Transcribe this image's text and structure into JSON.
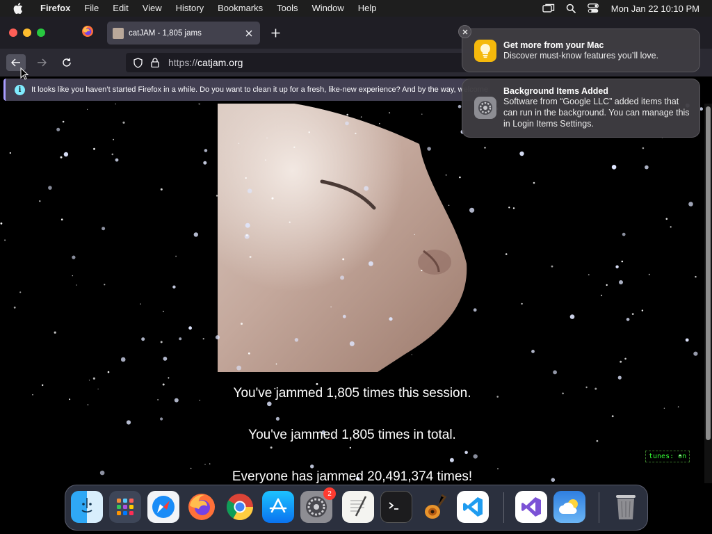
{
  "menubar": {
    "app_name": "Firefox",
    "items": [
      "File",
      "Edit",
      "View",
      "History",
      "Bookmarks",
      "Tools",
      "Window",
      "Help"
    ],
    "clock": "Mon Jan 22  10:10 PM"
  },
  "browser": {
    "tab_title": "catJAM - 1,805 jams",
    "url_protocol": "https://",
    "url_host": "catjam.org",
    "info_message": "It looks like you haven’t started Firefox in a while. Do you want to clean it up for a fresh, like-new experience? And by the way, welcome back!"
  },
  "page": {
    "session_text": "You've jammed 1,805 times this session.",
    "total_text": "You've jammed 1,805 times in total.",
    "everyone_text": "Everyone has jammed 20,491,374 times!",
    "tunes_label": "tunes:",
    "tunes_state": "on"
  },
  "notifications": [
    {
      "title": "Get more from your Mac",
      "body": "Discover must-know features you’ll love."
    },
    {
      "title": "Background Items Added",
      "body": "Software from “Google LLC” added items that can run in the background. You can manage this in Login Items Settings."
    }
  ],
  "dock": {
    "apps": [
      "Finder",
      "Launchpad",
      "Safari",
      "Firefox",
      "Google Chrome",
      "App Store",
      "System Settings",
      "TextEdit",
      "Terminal",
      "GarageBand",
      "Visual Studio Code",
      "Visual Studio",
      "Weather",
      "Trash"
    ],
    "system_settings_badge": "2"
  },
  "colors": {
    "accent_info": "#80ebff",
    "tunes_green": "#33ff33",
    "badge_red": "#ff3b30"
  }
}
